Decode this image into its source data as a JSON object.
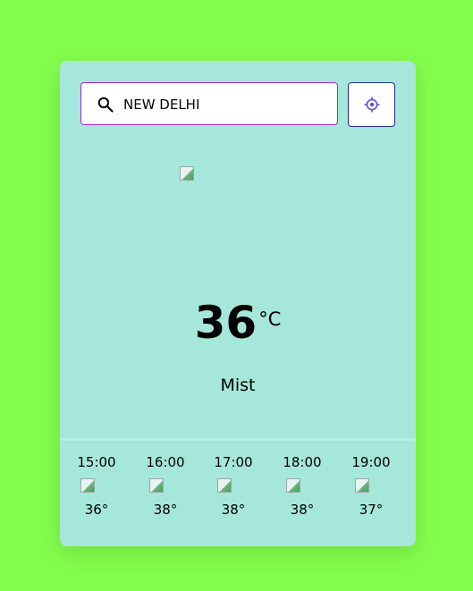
{
  "search": {
    "value": "NEW DELHI",
    "icon": "search-icon"
  },
  "locate_button": {
    "icon": "crosshair-location-icon",
    "color": "#5b4fd6"
  },
  "current": {
    "icon": "weather-condition-icon",
    "temperature": "36",
    "unit": "°C",
    "condition": "Mist"
  },
  "forecast": [
    {
      "time": "15:00",
      "temp": "36°",
      "icon": "weather-icon"
    },
    {
      "time": "16:00",
      "temp": "38°",
      "icon": "weather-icon"
    },
    {
      "time": "17:00",
      "temp": "38°",
      "icon": "weather-icon"
    },
    {
      "time": "18:00",
      "temp": "38°",
      "icon": "weather-icon"
    },
    {
      "time": "19:00",
      "temp": "37°",
      "icon": "weather-icon"
    }
  ],
  "colors": {
    "background": "#84fc4c",
    "card": "#a5e7da",
    "search_border": "#b221c9",
    "button_border": "#1e2c8f"
  }
}
